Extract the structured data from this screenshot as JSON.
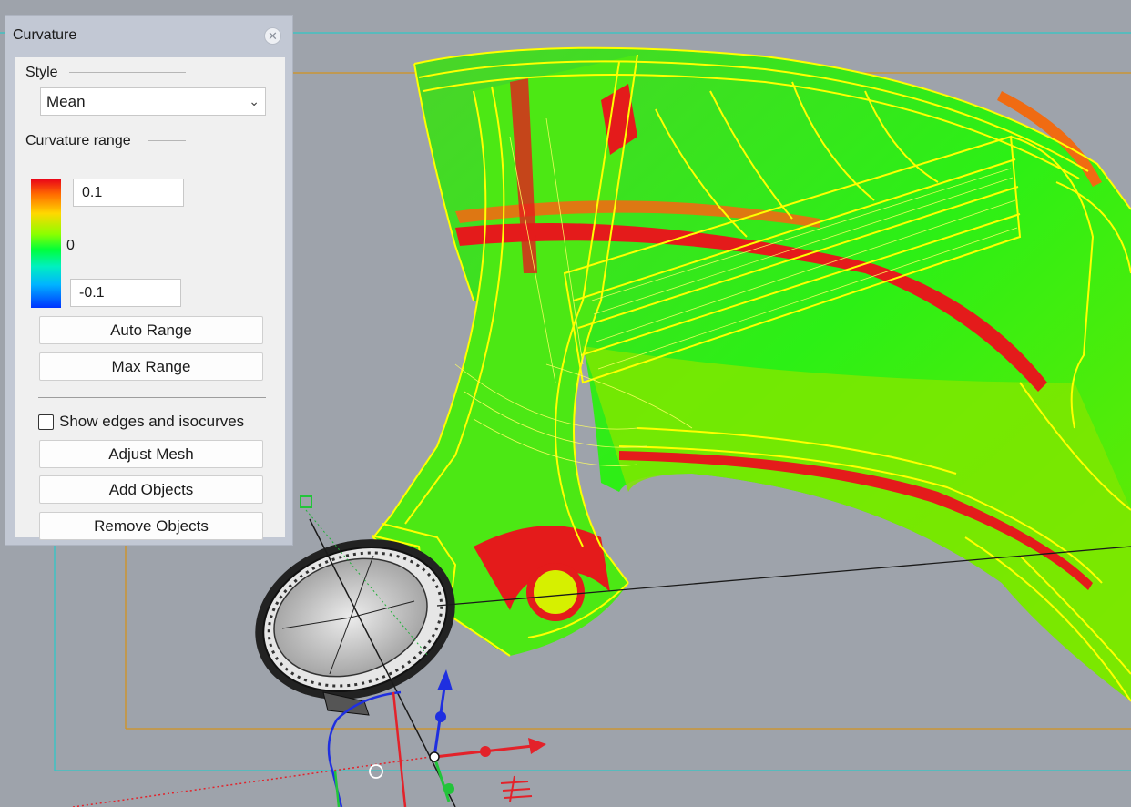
{
  "panel": {
    "title": "Curvature",
    "close_icon": "close-icon",
    "style_section": {
      "label": "Style",
      "selected_value": "Mean"
    },
    "range_section": {
      "label": "Curvature range",
      "max_value": "0.1",
      "mid_label": "0",
      "min_value": "-0.1",
      "gradient_colors": [
        "#e8001a",
        "#ffd800",
        "#00ff3a",
        "#0034ff"
      ]
    },
    "buttons": {
      "auto_range": "Auto Range",
      "max_range": "Max Range",
      "adjust_mesh": "Adjust Mesh",
      "add_objects": "Add Objects",
      "remove_objects": "Remove Objects"
    },
    "show_edges": {
      "label": "Show edges and isocurves",
      "checked": false
    }
  },
  "viewport": {
    "background_color": "#9ea3ab",
    "frame_colors": [
      "#2fc7c7",
      "#d3931f"
    ],
    "wireframe_color": "#ffff00",
    "gumball_axis_colors": [
      "#e3222a",
      "#1f2fe0",
      "#22c43a"
    ]
  }
}
